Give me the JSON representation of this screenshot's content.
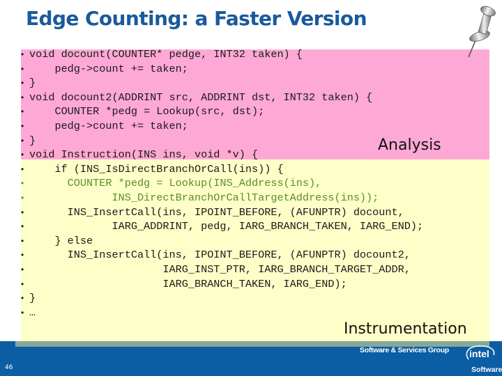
{
  "slide": {
    "title": "Edge Counting: a Faster Version",
    "page_number": "46"
  },
  "regions": {
    "analysis_label": "Analysis",
    "instrumentation_label": "Instrumentation"
  },
  "colors": {
    "analysis_bg": "#fea8d5",
    "instrumentation_bg": "#fefec8",
    "title": "#1a5a9c",
    "footer_bg": "#0b5ea4",
    "highlight_code": "#5b8e2a"
  },
  "code_lines": [
    {
      "text": "void docount(COUNTER* pedge, INT32 taken) {",
      "region": "analysis",
      "highlight": false
    },
    {
      "text": "    pedg->count += taken;",
      "region": "analysis",
      "highlight": false
    },
    {
      "text": "}",
      "region": "analysis",
      "highlight": false
    },
    {
      "text": "void docount2(ADDRINT src, ADDRINT dst, INT32 taken) {",
      "region": "analysis",
      "highlight": false
    },
    {
      "text": "    COUNTER *pedg = Lookup(src, dst);",
      "region": "analysis",
      "highlight": false
    },
    {
      "text": "    pedg->count += taken;",
      "region": "analysis",
      "highlight": false
    },
    {
      "text": "}",
      "region": "analysis",
      "highlight": false
    },
    {
      "text": "void Instruction(INS ins, void *v) {",
      "region": "analysis",
      "highlight": false
    },
    {
      "text": "    if (INS_IsDirectBranchOrCall(ins)) {",
      "region": "instrumentation",
      "highlight": false
    },
    {
      "text": "      COUNTER *pedg = Lookup(INS_Address(ins),",
      "region": "instrumentation",
      "highlight": true
    },
    {
      "text": "             INS_DirectBranchOrCallTargetAddress(ins));",
      "region": "instrumentation",
      "highlight": true
    },
    {
      "text": "      INS_InsertCall(ins, IPOINT_BEFORE, (AFUNPTR) docount,",
      "region": "instrumentation",
      "highlight": false
    },
    {
      "text": "             IARG_ADDRINT, pedg, IARG_BRANCH_TAKEN, IARG_END);",
      "region": "instrumentation",
      "highlight": false
    },
    {
      "text": "    } else",
      "region": "instrumentation",
      "highlight": false
    },
    {
      "text": "      INS_InsertCall(ins, IPOINT_BEFORE, (AFUNPTR) docount2,",
      "region": "instrumentation",
      "highlight": false
    },
    {
      "text": "                     IARG_INST_PTR, IARG_BRANCH_TARGET_ADDR,",
      "region": "instrumentation",
      "highlight": false
    },
    {
      "text": "                     IARG_BRANCH_TAKEN, IARG_END);",
      "region": "instrumentation",
      "highlight": false
    },
    {
      "text": "}",
      "region": "instrumentation",
      "highlight": false
    },
    {
      "text": "…",
      "region": "instrumentation",
      "highlight": false
    }
  ],
  "footer": {
    "group": "Software & Services Group",
    "logo_text": "intel",
    "logo_subtext": "Software"
  },
  "icons": {
    "decoration": "pushpin-icon",
    "logo": "intel-logo"
  }
}
